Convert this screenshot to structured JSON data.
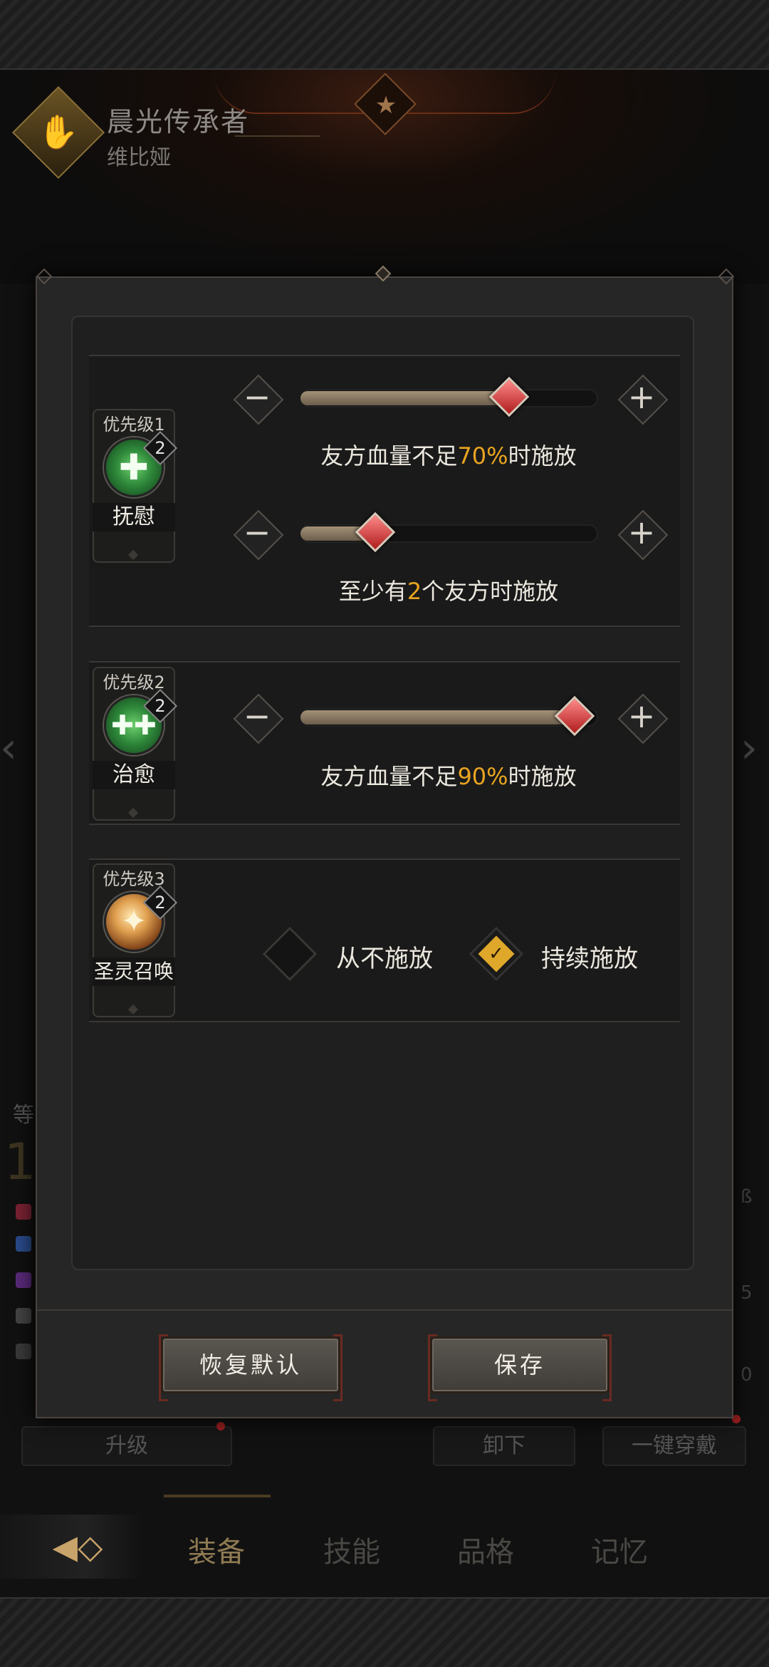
{
  "hero": {
    "title": "晨光传承者",
    "subtitle": "维比娅"
  },
  "background": {
    "left_label": "等",
    "left_value": "1",
    "right_marks": [
      "ß",
      "5",
      "0"
    ]
  },
  "skills": [
    {
      "priority": "优先级1",
      "name": "抚慰",
      "level": "2",
      "icon": "heal-plus-icon",
      "conditions": [
        {
          "prefix": "友方血量不足",
          "value": "70%",
          "suffix": "时施放",
          "level": 0.7
        },
        {
          "prefix": "至少有",
          "value": "2",
          "suffix": "个友方时施放",
          "level": 0.25
        }
      ]
    },
    {
      "priority": "优先级2",
      "name": "治愈",
      "level": "2",
      "icon": "multi-heal-icon",
      "conditions": [
        {
          "prefix": "友方血量不足",
          "value": "90%",
          "suffix": "时施放",
          "level": 0.92
        }
      ]
    },
    {
      "priority": "优先级3",
      "name": "圣灵召唤",
      "level": "2",
      "icon": "holy-summon-icon",
      "options": [
        {
          "label": "从不施放",
          "checked": false
        },
        {
          "label": "持续施放",
          "checked": true
        }
      ]
    }
  ],
  "controls": {
    "minus": "−",
    "plus": "+"
  },
  "dialog_buttons": {
    "reset": "恢复默认",
    "save": "保存"
  },
  "under_buttons": {
    "upgrade": "升级",
    "unequip": "卸下",
    "equip_all": "一键穿戴"
  },
  "nav": {
    "tabs": [
      "装备",
      "技能",
      "品格",
      "记忆"
    ],
    "active": "装备"
  },
  "colors": {
    "highlight": "#e8a420",
    "slider_fill": "#8a7a64",
    "handle": "#c62828"
  }
}
